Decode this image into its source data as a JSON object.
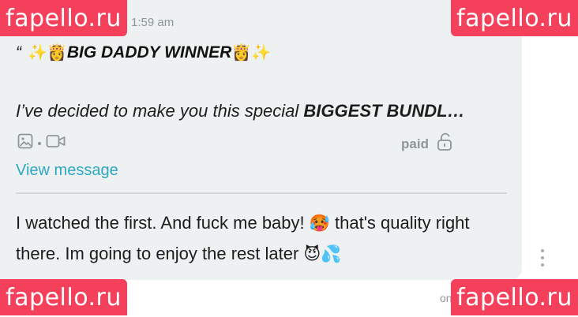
{
  "message": {
    "timestamp": "1:59 am",
    "title_quote": "“",
    "title_emoji_left": "✨👸",
    "title_text": "BIG DADDY WINNER",
    "title_emoji_right": "👸✨",
    "body_regular": "I’ve decided to make you this special ",
    "body_bold": "BIGGEST BUNDL…",
    "paid_label": "paid",
    "view_message_label": "View message",
    "media_icons": [
      "image-icon",
      "video-icon"
    ],
    "lock_icon": "unlock-icon"
  },
  "reply": {
    "text_part1": "I watched the first. And fuck me baby! ",
    "emoji_1": "🥵",
    "text_part2": " that's quality right there. Im going to enjoy the rest later ",
    "emoji_2": "😈💦"
  },
  "footer": {
    "text": "on"
  },
  "watermark": {
    "text": "fapello.ru",
    "color": "#f4405b"
  },
  "colors": {
    "bubble_bg": "#eef1f2",
    "link": "#2ea7c4",
    "muted": "#8f9699"
  }
}
